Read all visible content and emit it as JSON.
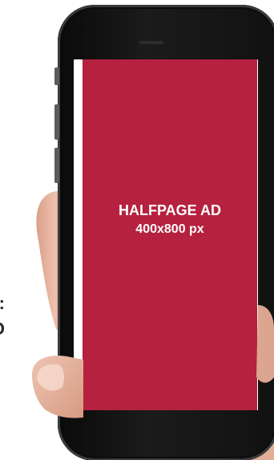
{
  "side_text": {
    "line1": ":",
    "line2": "O"
  },
  "ad": {
    "title": "HALFPAGE AD",
    "size": "400x800 px",
    "background": "#b5213e",
    "text_color": "#ffffff"
  },
  "phone": {
    "body_color": "#111111"
  }
}
